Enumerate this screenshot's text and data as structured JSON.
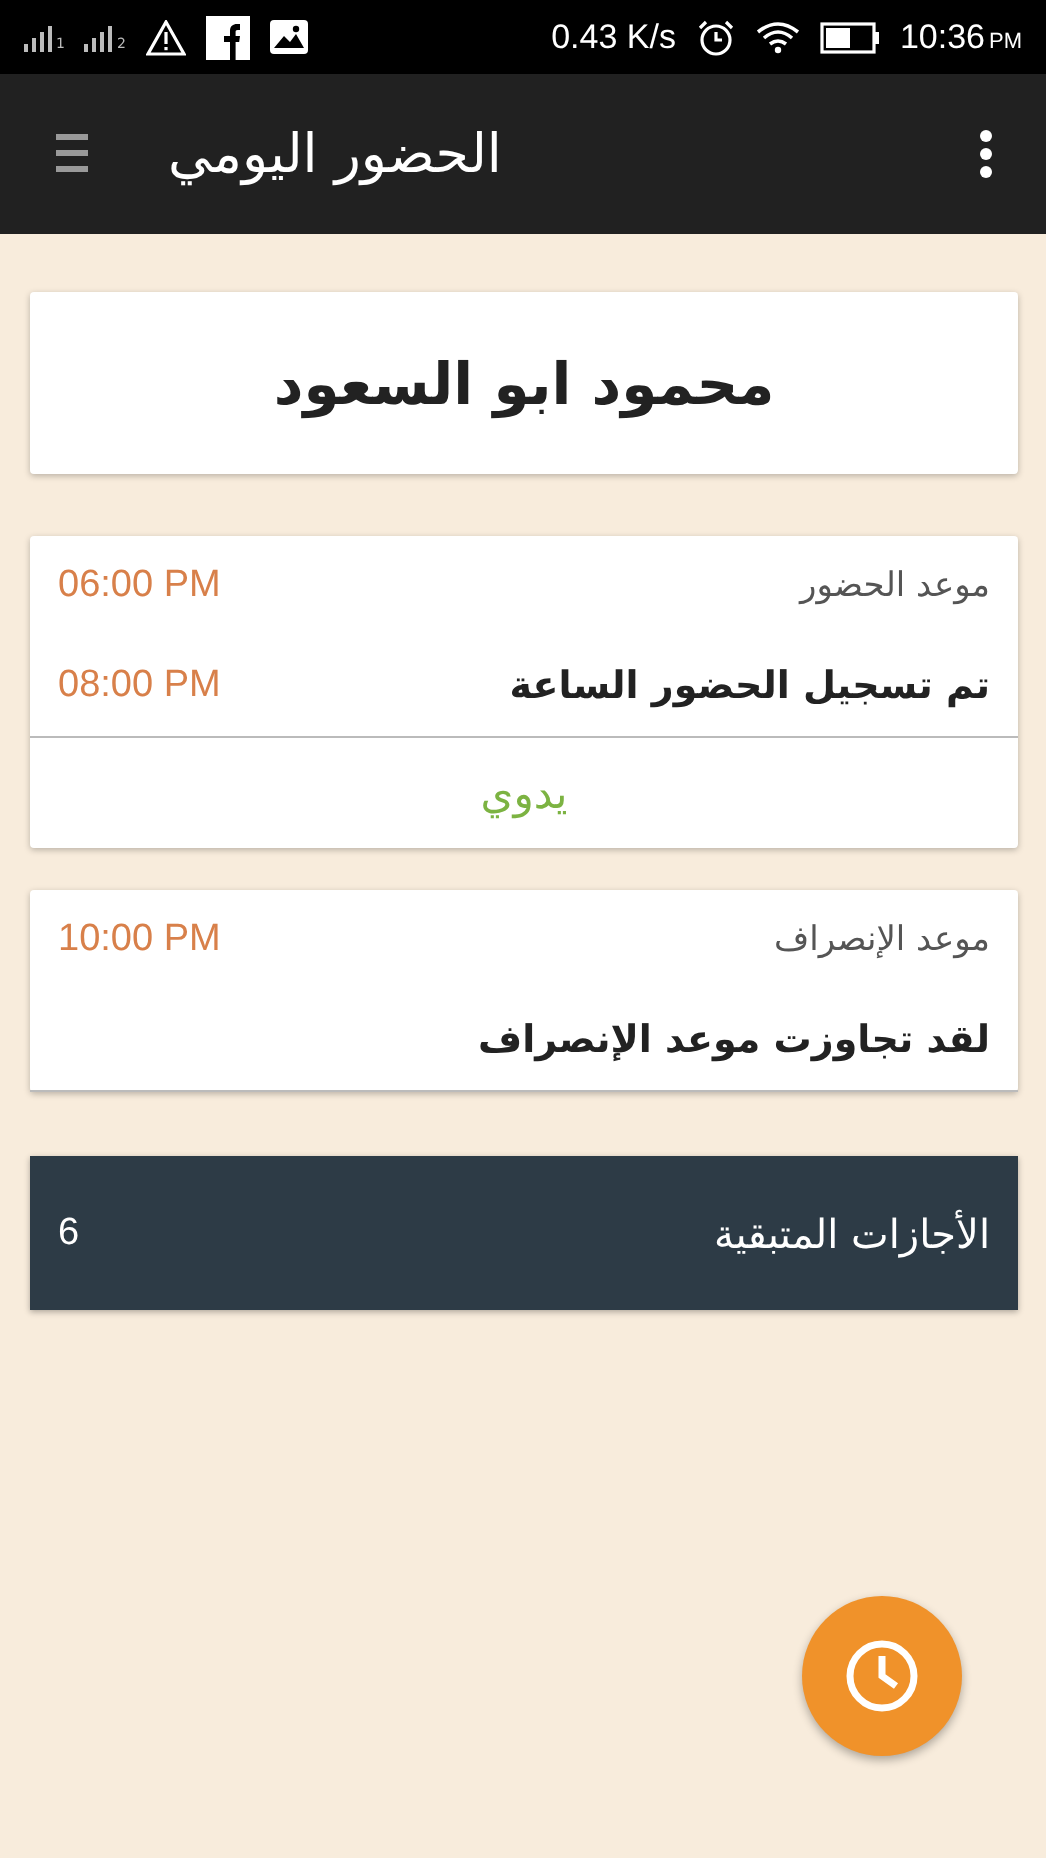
{
  "status_bar": {
    "sim_1_label": "1",
    "sim_2_label": "2",
    "speed": "0.43 K/s",
    "time": "10:36",
    "ampm": "PM"
  },
  "app_bar": {
    "title": "الحضور اليومي"
  },
  "employee": {
    "name": "محمود ابو السعود"
  },
  "attendance": {
    "label": "موعد الحضور",
    "scheduled": "06:00 PM",
    "message": "تم تسجيل الحضور الساعة",
    "recorded": "08:00 PM",
    "method": "يدوي"
  },
  "departure": {
    "label": "موعد الإنصراف",
    "scheduled": "10:00 PM",
    "message": "لقد تجاوزت موعد الإنصراف"
  },
  "leave": {
    "label": "الأجازات المتبقية",
    "count": "6"
  }
}
